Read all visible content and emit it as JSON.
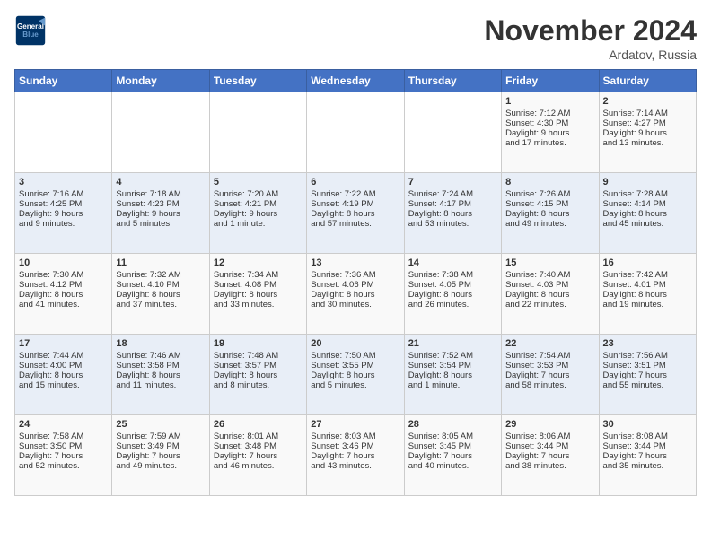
{
  "header": {
    "logo_line1": "General",
    "logo_line2": "Blue",
    "month": "November 2024",
    "location": "Ardatov, Russia"
  },
  "weekdays": [
    "Sunday",
    "Monday",
    "Tuesday",
    "Wednesday",
    "Thursday",
    "Friday",
    "Saturday"
  ],
  "weeks": [
    [
      {
        "day": "",
        "info": ""
      },
      {
        "day": "",
        "info": ""
      },
      {
        "day": "",
        "info": ""
      },
      {
        "day": "",
        "info": ""
      },
      {
        "day": "",
        "info": ""
      },
      {
        "day": "1",
        "info": "Sunrise: 7:12 AM\nSunset: 4:30 PM\nDaylight: 9 hours\nand 17 minutes."
      },
      {
        "day": "2",
        "info": "Sunrise: 7:14 AM\nSunset: 4:27 PM\nDaylight: 9 hours\nand 13 minutes."
      }
    ],
    [
      {
        "day": "3",
        "info": "Sunrise: 7:16 AM\nSunset: 4:25 PM\nDaylight: 9 hours\nand 9 minutes."
      },
      {
        "day": "4",
        "info": "Sunrise: 7:18 AM\nSunset: 4:23 PM\nDaylight: 9 hours\nand 5 minutes."
      },
      {
        "day": "5",
        "info": "Sunrise: 7:20 AM\nSunset: 4:21 PM\nDaylight: 9 hours\nand 1 minute."
      },
      {
        "day": "6",
        "info": "Sunrise: 7:22 AM\nSunset: 4:19 PM\nDaylight: 8 hours\nand 57 minutes."
      },
      {
        "day": "7",
        "info": "Sunrise: 7:24 AM\nSunset: 4:17 PM\nDaylight: 8 hours\nand 53 minutes."
      },
      {
        "day": "8",
        "info": "Sunrise: 7:26 AM\nSunset: 4:15 PM\nDaylight: 8 hours\nand 49 minutes."
      },
      {
        "day": "9",
        "info": "Sunrise: 7:28 AM\nSunset: 4:14 PM\nDaylight: 8 hours\nand 45 minutes."
      }
    ],
    [
      {
        "day": "10",
        "info": "Sunrise: 7:30 AM\nSunset: 4:12 PM\nDaylight: 8 hours\nand 41 minutes."
      },
      {
        "day": "11",
        "info": "Sunrise: 7:32 AM\nSunset: 4:10 PM\nDaylight: 8 hours\nand 37 minutes."
      },
      {
        "day": "12",
        "info": "Sunrise: 7:34 AM\nSunset: 4:08 PM\nDaylight: 8 hours\nand 33 minutes."
      },
      {
        "day": "13",
        "info": "Sunrise: 7:36 AM\nSunset: 4:06 PM\nDaylight: 8 hours\nand 30 minutes."
      },
      {
        "day": "14",
        "info": "Sunrise: 7:38 AM\nSunset: 4:05 PM\nDaylight: 8 hours\nand 26 minutes."
      },
      {
        "day": "15",
        "info": "Sunrise: 7:40 AM\nSunset: 4:03 PM\nDaylight: 8 hours\nand 22 minutes."
      },
      {
        "day": "16",
        "info": "Sunrise: 7:42 AM\nSunset: 4:01 PM\nDaylight: 8 hours\nand 19 minutes."
      }
    ],
    [
      {
        "day": "17",
        "info": "Sunrise: 7:44 AM\nSunset: 4:00 PM\nDaylight: 8 hours\nand 15 minutes."
      },
      {
        "day": "18",
        "info": "Sunrise: 7:46 AM\nSunset: 3:58 PM\nDaylight: 8 hours\nand 11 minutes."
      },
      {
        "day": "19",
        "info": "Sunrise: 7:48 AM\nSunset: 3:57 PM\nDaylight: 8 hours\nand 8 minutes."
      },
      {
        "day": "20",
        "info": "Sunrise: 7:50 AM\nSunset: 3:55 PM\nDaylight: 8 hours\nand 5 minutes."
      },
      {
        "day": "21",
        "info": "Sunrise: 7:52 AM\nSunset: 3:54 PM\nDaylight: 8 hours\nand 1 minute."
      },
      {
        "day": "22",
        "info": "Sunrise: 7:54 AM\nSunset: 3:53 PM\nDaylight: 7 hours\nand 58 minutes."
      },
      {
        "day": "23",
        "info": "Sunrise: 7:56 AM\nSunset: 3:51 PM\nDaylight: 7 hours\nand 55 minutes."
      }
    ],
    [
      {
        "day": "24",
        "info": "Sunrise: 7:58 AM\nSunset: 3:50 PM\nDaylight: 7 hours\nand 52 minutes."
      },
      {
        "day": "25",
        "info": "Sunrise: 7:59 AM\nSunset: 3:49 PM\nDaylight: 7 hours\nand 49 minutes."
      },
      {
        "day": "26",
        "info": "Sunrise: 8:01 AM\nSunset: 3:48 PM\nDaylight: 7 hours\nand 46 minutes."
      },
      {
        "day": "27",
        "info": "Sunrise: 8:03 AM\nSunset: 3:46 PM\nDaylight: 7 hours\nand 43 minutes."
      },
      {
        "day": "28",
        "info": "Sunrise: 8:05 AM\nSunset: 3:45 PM\nDaylight: 7 hours\nand 40 minutes."
      },
      {
        "day": "29",
        "info": "Sunrise: 8:06 AM\nSunset: 3:44 PM\nDaylight: 7 hours\nand 38 minutes."
      },
      {
        "day": "30",
        "info": "Sunrise: 8:08 AM\nSunset: 3:44 PM\nDaylight: 7 hours\nand 35 minutes."
      }
    ]
  ]
}
